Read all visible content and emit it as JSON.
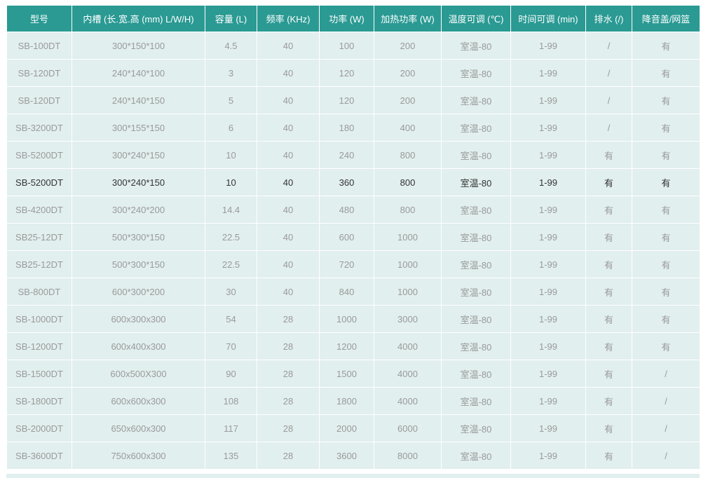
{
  "table": {
    "headers": [
      "型号",
      "内槽 (长.宽.高 (mm) L/W/H)",
      "容量 (L)",
      "频率 (KHz)",
      "功率 (W)",
      "加热功率 (W)",
      "温度可调 (℃)",
      "时间可调 (min)",
      "排水 (/)",
      "降音盖/网篮"
    ],
    "rows": [
      [
        "SB-100DT",
        "300*150*100",
        "4.5",
        "40",
        "100",
        "200",
        "室温-80",
        "1-99",
        "/",
        "有"
      ],
      [
        "SB-120DT",
        "240*140*100",
        "3",
        "40",
        "120",
        "200",
        "室温-80",
        "1-99",
        "/",
        "有"
      ],
      [
        "SB-120DT",
        "240*140*150",
        "5",
        "40",
        "120",
        "200",
        "室温-80",
        "1-99",
        "/",
        "有"
      ],
      [
        "SB-3200DT",
        "300*155*150",
        "6",
        "40",
        "180",
        "400",
        "室温-80",
        "1-99",
        "/",
        "有"
      ],
      [
        "SB-5200DT",
        "300*240*150",
        "10",
        "40",
        "240",
        "800",
        "室温-80",
        "1-99",
        "有",
        "有"
      ],
      [
        "SB-5200DT",
        "300*240*150",
        "10",
        "40",
        "360",
        "800",
        "室温-80",
        "1-99",
        "有",
        "有"
      ],
      [
        "SB-4200DT",
        "300*240*200",
        "14.4",
        "40",
        "480",
        "800",
        "室温-80",
        "1-99",
        "有",
        "有"
      ],
      [
        "SB25-12DT",
        "500*300*150",
        "22.5",
        "40",
        "600",
        "1000",
        "室温-80",
        "1-99",
        "有",
        "有"
      ],
      [
        "SB25-12DT",
        "500*300*150",
        "22.5",
        "40",
        "720",
        "1000",
        "室温-80",
        "1-99",
        "有",
        "有"
      ],
      [
        "SB-800DT",
        "600*300*200",
        "30",
        "40",
        "840",
        "1000",
        "室温-80",
        "1-99",
        "有",
        "有"
      ],
      [
        "SB-1000DT",
        "600x300x300",
        "54",
        "28",
        "1000",
        "3000",
        "室温-80",
        "1-99",
        "有",
        "有"
      ],
      [
        "SB-1200DT",
        "600x400x300",
        "70",
        "28",
        "1200",
        "4000",
        "室温-80",
        "1-99",
        "有",
        "有"
      ],
      [
        "SB-1500DT",
        "600x500X300",
        "90",
        "28",
        "1500",
        "4000",
        "室温-80",
        "1-99",
        "有",
        "/"
      ],
      [
        "SB-1800DT",
        "600x600x300",
        "108",
        "28",
        "1800",
        "4000",
        "室温-80",
        "1-99",
        "有",
        "/"
      ],
      [
        "SB-2000DT",
        "650x600x300",
        "117",
        "28",
        "2000",
        "6000",
        "室温-80",
        "1-99",
        "有",
        "/"
      ],
      [
        "SB-3600DT",
        "750x600x300",
        "135",
        "28",
        "3600",
        "8000",
        "室温-80",
        "1-99",
        "有",
        "/"
      ]
    ]
  }
}
